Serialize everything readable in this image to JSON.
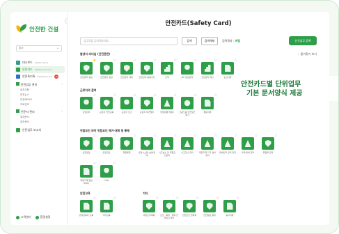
{
  "app": {
    "logo_text": "안전한 건설",
    "site_select": "본사"
  },
  "sidebar": {
    "items": [
      {
        "label": "대시보드",
        "sub": "Safety Home"
      },
      {
        "label": "안전카드",
        "sub": "Safetycard Card"
      },
      {
        "label": "안전톡디톡",
        "sub": "Safetytalk Tool",
        "badge": "N"
      }
    ],
    "groups": [
      {
        "title": "안전업무 관리",
        "subs": [
          "공지사항",
          "안전뉴스",
          "안전NEWS",
          "자료관리"
        ]
      },
      {
        "title": "전문서 관리",
        "subs": [
          "결재문서",
          "참조문서"
        ]
      }
    ],
    "report_label": "안전업무 보고서",
    "footer": {
      "customer": "고객센터",
      "settings": "환경설정"
    }
  },
  "main": {
    "title": "안전카드(Safety Card)",
    "search_placeholder": "업무명을 검색해보세요",
    "search_button": "검색",
    "reset_button": "검색해제",
    "result_prefix": "검색결과 :",
    "result_count": "버림",
    "register_button": "신규업무 등록",
    "fav_label": "즐겨찾기 보기"
  },
  "sections": [
    {
      "label": "발생자 리더십 (안전관련)",
      "cards": [
        {
          "label": "안전관리 점검",
          "icon": "shield",
          "fav": true
        },
        {
          "label": "안전관리 점검",
          "icon": "shield",
          "fav": false
        },
        {
          "label": "안전관리 계획",
          "icon": "shield",
          "fav": false
        },
        {
          "label": "안전관리 활동사진",
          "icon": "shield",
          "fav": false
        },
        {
          "label": "조직",
          "icon": "bars",
          "fav": false
        },
        {
          "label": "MR 점검관리",
          "icon": "person",
          "fav": false
        },
        {
          "label": "안전관리 계산",
          "icon": "bars",
          "fav": false
        },
        {
          "label": "보고서류",
          "icon": "doc",
          "fav": false
        }
      ]
    },
    {
      "label": "근로자의 참여",
      "cards": [
        {
          "label": "출입관리",
          "icon": "person",
          "fav": false
        },
        {
          "label": "근로자 안전교육",
          "icon": "shield",
          "fav": false
        },
        {
          "label": "근로자 신고",
          "icon": "person",
          "fav": false
        },
        {
          "label": "근로자 의견청취",
          "icon": "shield",
          "fav": false
        },
        {
          "label": "위험성평가결과",
          "icon": "tri",
          "fav": false
        },
        {
          "label": "고용노동 안전보건 평가",
          "icon": "sun",
          "fav": false
        },
        {
          "label": "결문서류",
          "icon": "doc",
          "fav": false
        }
      ]
    },
    {
      "label": "위험요인 파악 위험요인 제거·대체 및 통제",
      "cards": [
        {
          "label": "안전점검",
          "icon": "shield",
          "fav": false
        },
        {
          "label": "안전진단",
          "icon": "shield",
          "fav": false
        },
        {
          "label": "위험물질",
          "icon": "shield",
          "fav": false
        },
        {
          "label": "안전시스템 (설비관리)",
          "icon": "shield",
          "fav": false
        },
        {
          "label": "시그널소 및 위험요인관리",
          "icon": "tri",
          "fav": false
        },
        {
          "label": "사고조사 관리",
          "icon": "tri",
          "fav": false
        },
        {
          "label": "위험기계·기구 설치 관리",
          "icon": "tri",
          "fav": false
        },
        {
          "label": "유해인자 관리 관리",
          "icon": "tri",
          "fav": false
        },
        {
          "label": "사회/유해 관리",
          "icon": "tri",
          "fav": false
        },
        {
          "label": "위험물 관리",
          "icon": "shield",
          "fav": false
        }
      ]
    },
    {
      "label": "",
      "cards": [
        {
          "label": "위험기계 점검(PSM)",
          "icon": "doc",
          "fav": false
        },
        {
          "label": "TBM",
          "icon": "person",
          "fav": false
        }
      ]
    },
    {
      "label": "안전교육",
      "cards": [
        {
          "label": "관리감독자 교육",
          "icon": "doc",
          "fav": false
        },
        {
          "label": "기타교육",
          "icon": "doc",
          "fav": false
        }
      ]
    },
    {
      "label": "기타",
      "cards": [
        {
          "label": "비상조치계획",
          "icon": "shield",
          "fav": false
        },
        {
          "label": "도급 · 용역 · 위탁 안전보건 평가",
          "icon": "shield",
          "fav": false
        },
        {
          "label": "안전보건 협의회",
          "icon": "shield",
          "fav": false
        },
        {
          "label": "안전점검 결과",
          "icon": "shield",
          "fav": false
        },
        {
          "label": "공사서류",
          "icon": "doc",
          "fav": false
        }
      ]
    }
  ],
  "overlay": {
    "line1": "안전카드별 단위업무",
    "line2": "기본 문서양식 제공"
  },
  "colors": {
    "accent": "#2e9e49",
    "star": "#f4b400",
    "badge": "#e74c3c"
  }
}
